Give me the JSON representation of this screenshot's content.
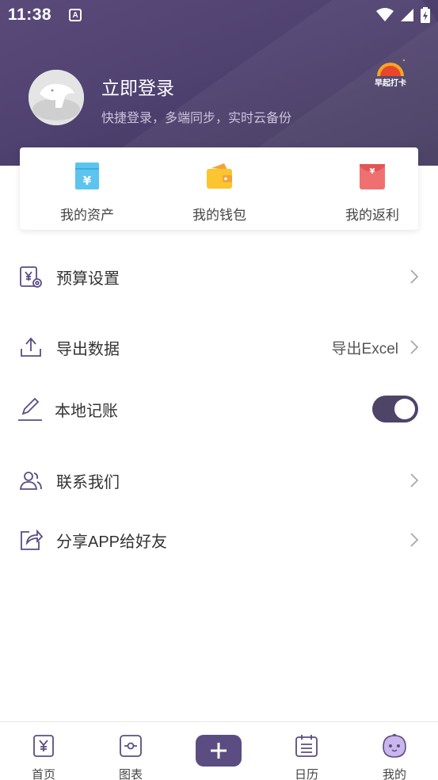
{
  "status_bar": {
    "time": "11:38",
    "notification_badge": "A"
  },
  "profile": {
    "title": "立即登录",
    "subtitle": "快捷登录，多端同步，实时云备份",
    "checkin_label": "早起打卡"
  },
  "quick_actions": [
    {
      "label": "我的资产",
      "icon": "asset-yen-icon"
    },
    {
      "label": "我的钱包",
      "icon": "wallet-icon"
    },
    {
      "label": "我的返利",
      "icon": "red-envelope-icon"
    }
  ],
  "menu": {
    "budget": {
      "label": "预算设置",
      "icon": "budget-settings-icon"
    },
    "export": {
      "label": "导出数据",
      "value": "导出Excel",
      "icon": "export-upload-icon"
    },
    "local": {
      "label": "本地记账",
      "toggle_on": true,
      "icon": "pencil-icon"
    },
    "contact": {
      "label": "联系我们",
      "icon": "contacts-icon"
    },
    "share": {
      "label": "分享APP给好友",
      "icon": "share-icon"
    }
  },
  "tabbar": {
    "home": "首页",
    "chart": "图表",
    "calendar": "日历",
    "mine": "我的"
  },
  "colors": {
    "header_bg": "#4f4170",
    "accent": "#5b4d82",
    "icon_stroke": "#5b4d82"
  }
}
